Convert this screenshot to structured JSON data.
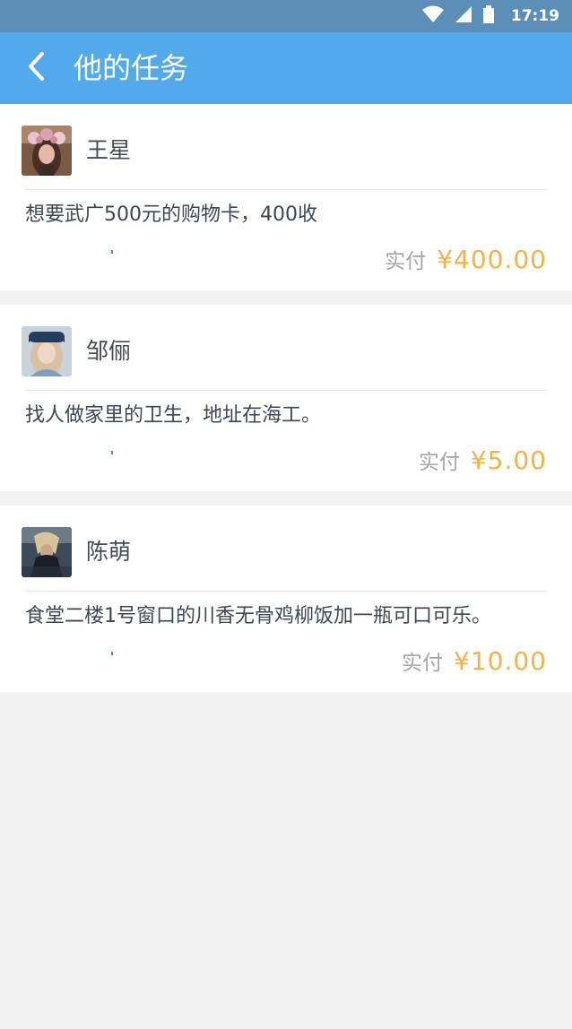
{
  "status_bar": {
    "time": "17:19",
    "icons": [
      "wifi-icon",
      "signal-icon",
      "battery-icon"
    ]
  },
  "header": {
    "title": "他的任务",
    "back_icon": "chevron-left-icon"
  },
  "colors": {
    "status_bar": "#5b8fb8",
    "app_bar": "#52aaea",
    "amount": "#f5b342",
    "background": "#f2f2f2"
  },
  "tasks": [
    {
      "name": "王星",
      "description": "想要武广500元的购物卡，400收",
      "pay_label": "实付",
      "amount": "¥400.00"
    },
    {
      "name": "邹俪",
      "description": "找人做家里的卫生，地址在海工。",
      "pay_label": "实付",
      "amount": "¥5.00"
    },
    {
      "name": "陈萌",
      "description": "食堂二楼1号窗口的川香无骨鸡柳饭加一瓶可口可乐。",
      "pay_label": "实付",
      "amount": "¥10.00"
    }
  ]
}
